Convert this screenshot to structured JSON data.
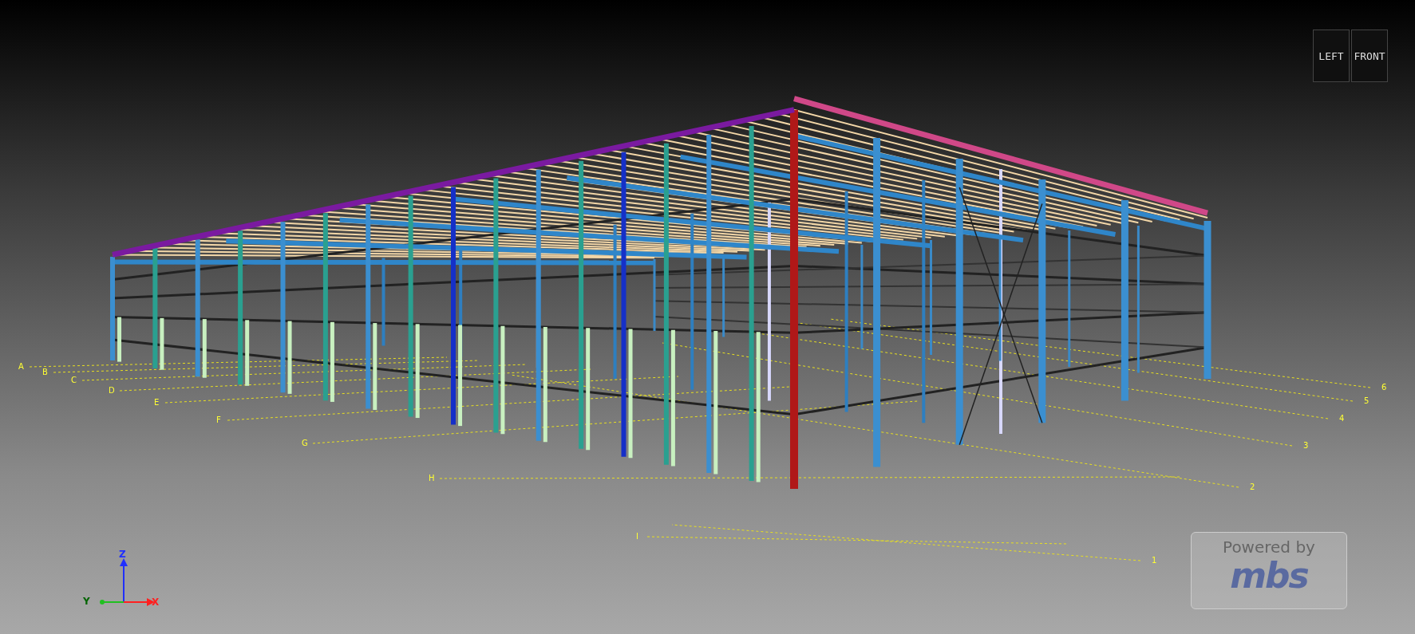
{
  "view_cube": {
    "faces": [
      "LEFT",
      "FRONT"
    ]
  },
  "grid_labels": {
    "letters": [
      "A",
      "B",
      "C",
      "D",
      "E",
      "F",
      "G",
      "H",
      "I"
    ],
    "numbers": [
      "6",
      "5",
      "4",
      "3",
      "2",
      "1"
    ]
  },
  "axis_triad": {
    "labels": [
      "Z",
      "Y",
      "X"
    ]
  },
  "branding": {
    "caption": "Powered by",
    "logo_text": "mbs"
  }
}
